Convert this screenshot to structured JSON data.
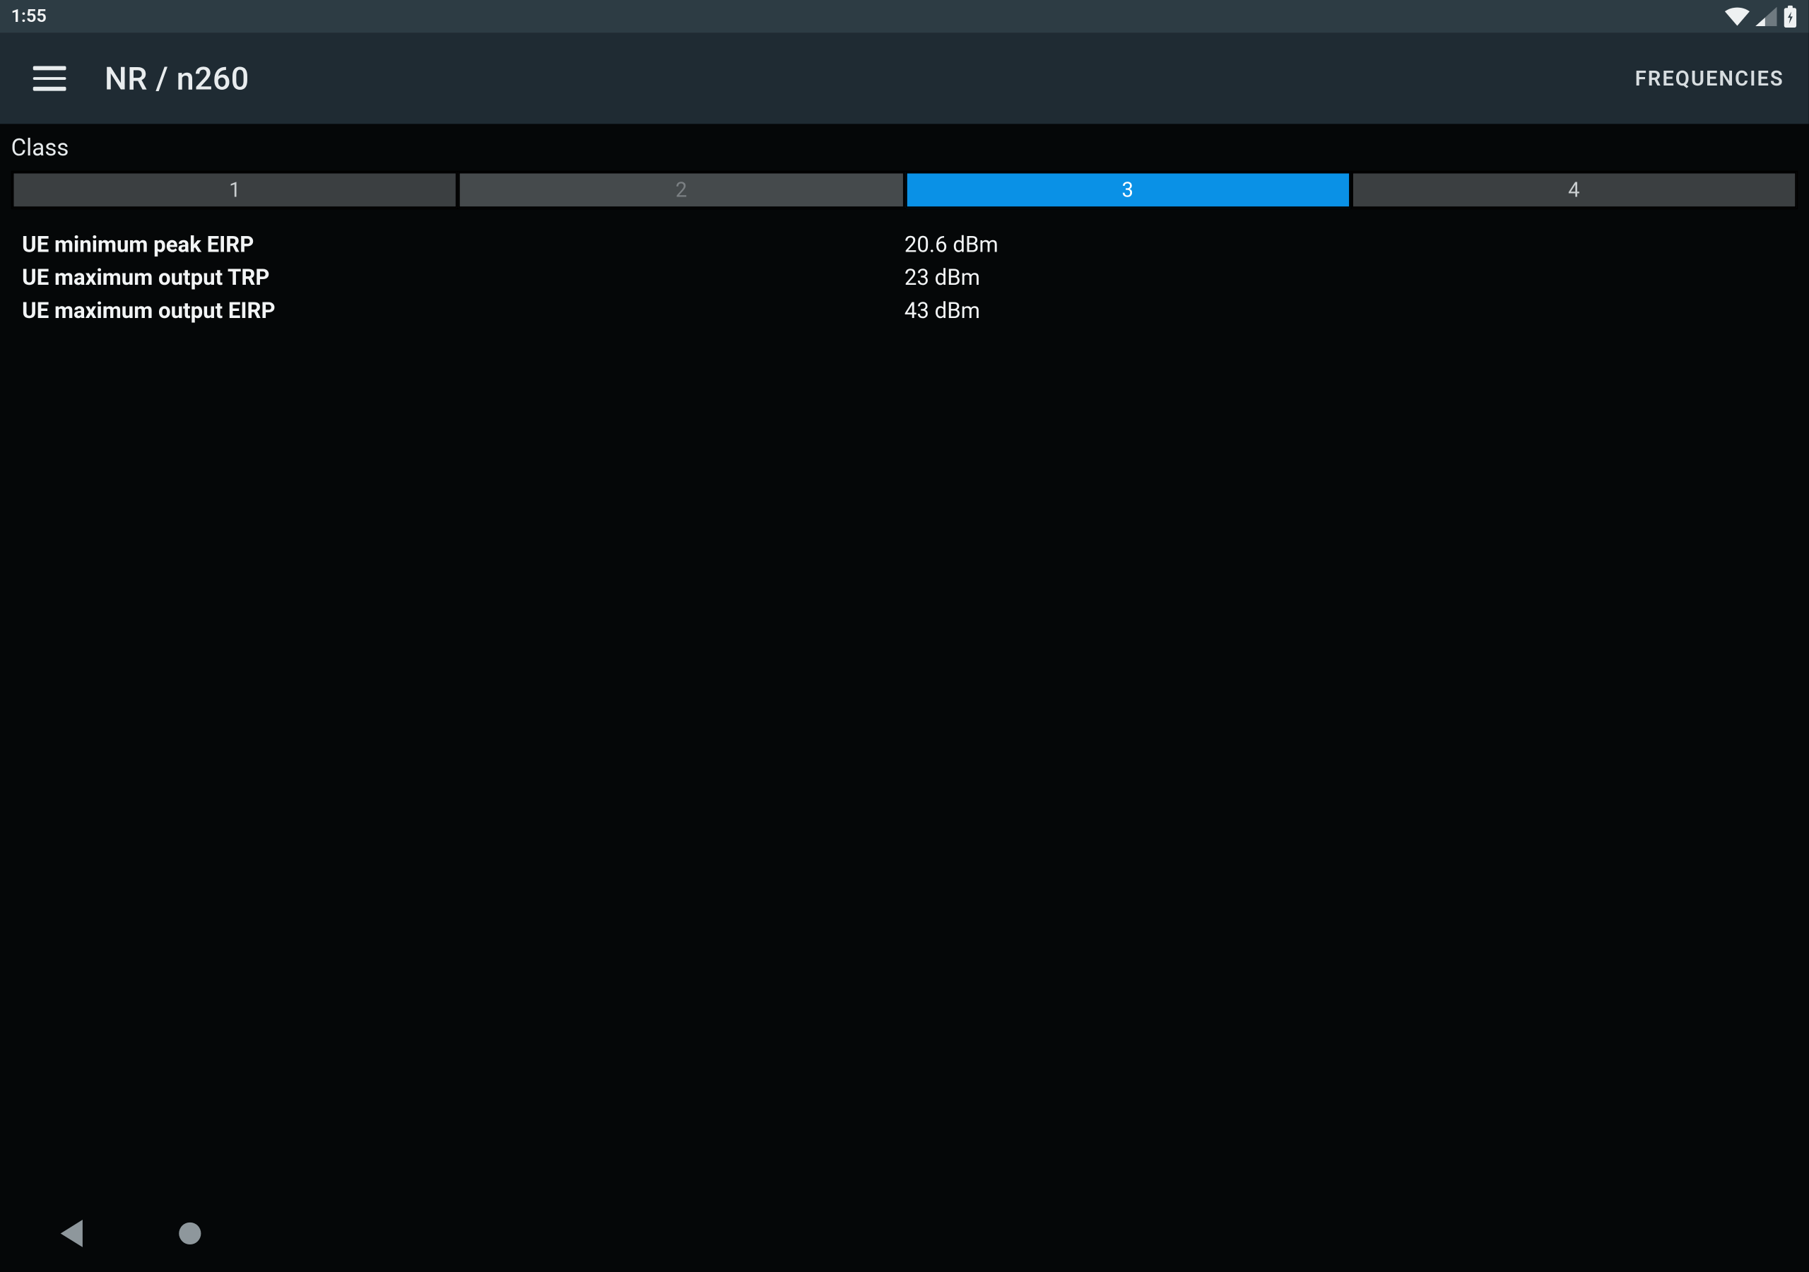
{
  "status": {
    "time": "1:55"
  },
  "appbar": {
    "title": "NR / n260",
    "action_label": "FREQUENCIES"
  },
  "section_label": "Class",
  "class_tabs": [
    {
      "label": "1",
      "state": "enabled"
    },
    {
      "label": "2",
      "state": "disabled"
    },
    {
      "label": "3",
      "state": "selected"
    },
    {
      "label": "4",
      "state": "enabled"
    }
  ],
  "specs": [
    {
      "key": "UE minimum peak EIRP",
      "value": "20.6 dBm"
    },
    {
      "key": "UE maximum output TRP",
      "value": "23 dBm"
    },
    {
      "key": "UE maximum output EIRP",
      "value": "43 dBm"
    }
  ]
}
